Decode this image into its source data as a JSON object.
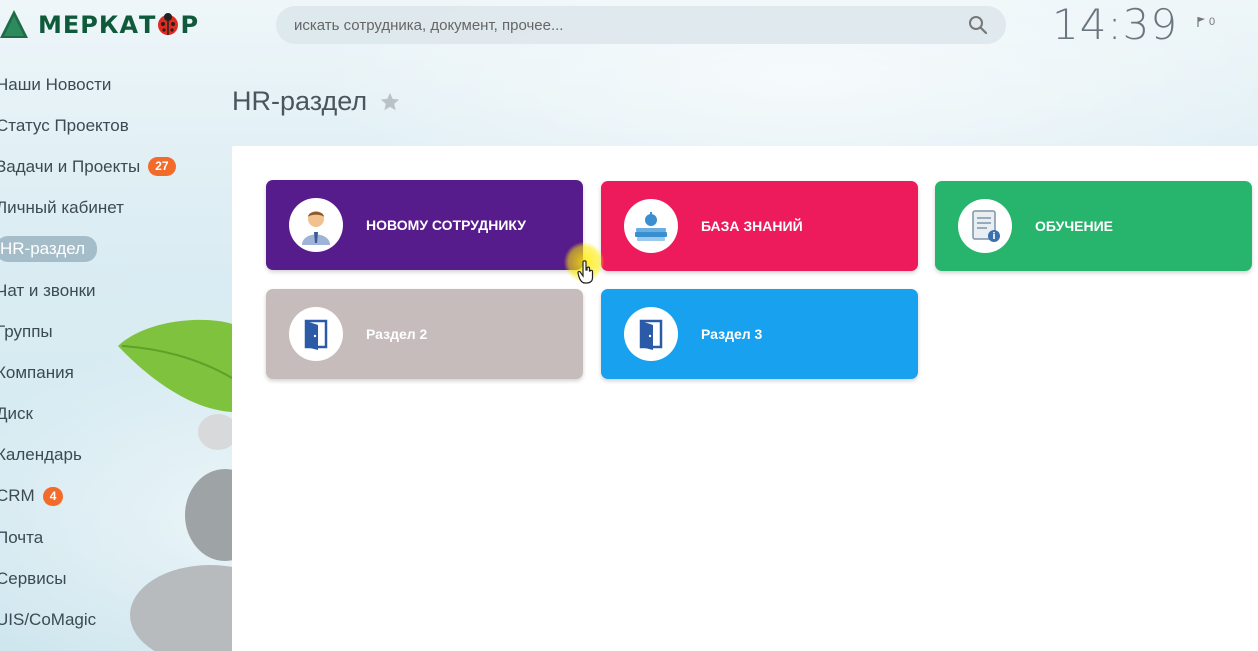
{
  "app": {
    "logo_text_left": "МЕРКАТ",
    "logo_text_right": "Р",
    "brand_color": "#0f5a3b"
  },
  "search": {
    "placeholder": "искать сотрудника, документ, прочее..."
  },
  "clock": "14:39",
  "notifications": {
    "count": "0"
  },
  "sidebar": {
    "items": [
      {
        "label": "Наши Новости"
      },
      {
        "label": "Статус Проектов"
      },
      {
        "label": "Задачи и Проекты",
        "badge": "27"
      },
      {
        "label": "Личный кабинет"
      },
      {
        "label": "HR-раздел",
        "active": true
      },
      {
        "label": "Чат и звонки"
      },
      {
        "label": "Группы"
      },
      {
        "label": "Компания"
      },
      {
        "label": "Диск"
      },
      {
        "label": "Календарь"
      },
      {
        "label": "CRM",
        "badge": "4"
      },
      {
        "label": "Почта"
      },
      {
        "label": "Сервисы"
      },
      {
        "label": "UIS/CoMagic"
      }
    ]
  },
  "page": {
    "title": "HR-раздел"
  },
  "tiles": [
    {
      "label": "НОВОМУ СОТРУДНИКУ",
      "color": "#571c8c",
      "icon": "new-employee-icon"
    },
    {
      "label": "БАЗА ЗНАНИЙ",
      "color": "#ee1b5c",
      "icon": "knowledge-base-icon"
    },
    {
      "label": "ОБУЧЕНИЕ",
      "color": "#27b56e",
      "icon": "training-document-icon"
    },
    {
      "label": "Раздел 2",
      "color": "#c6bcbb",
      "icon": "folder-door-icon"
    },
    {
      "label": "Раздел 3",
      "color": "#18a1ee",
      "icon": "folder-door-icon"
    }
  ]
}
